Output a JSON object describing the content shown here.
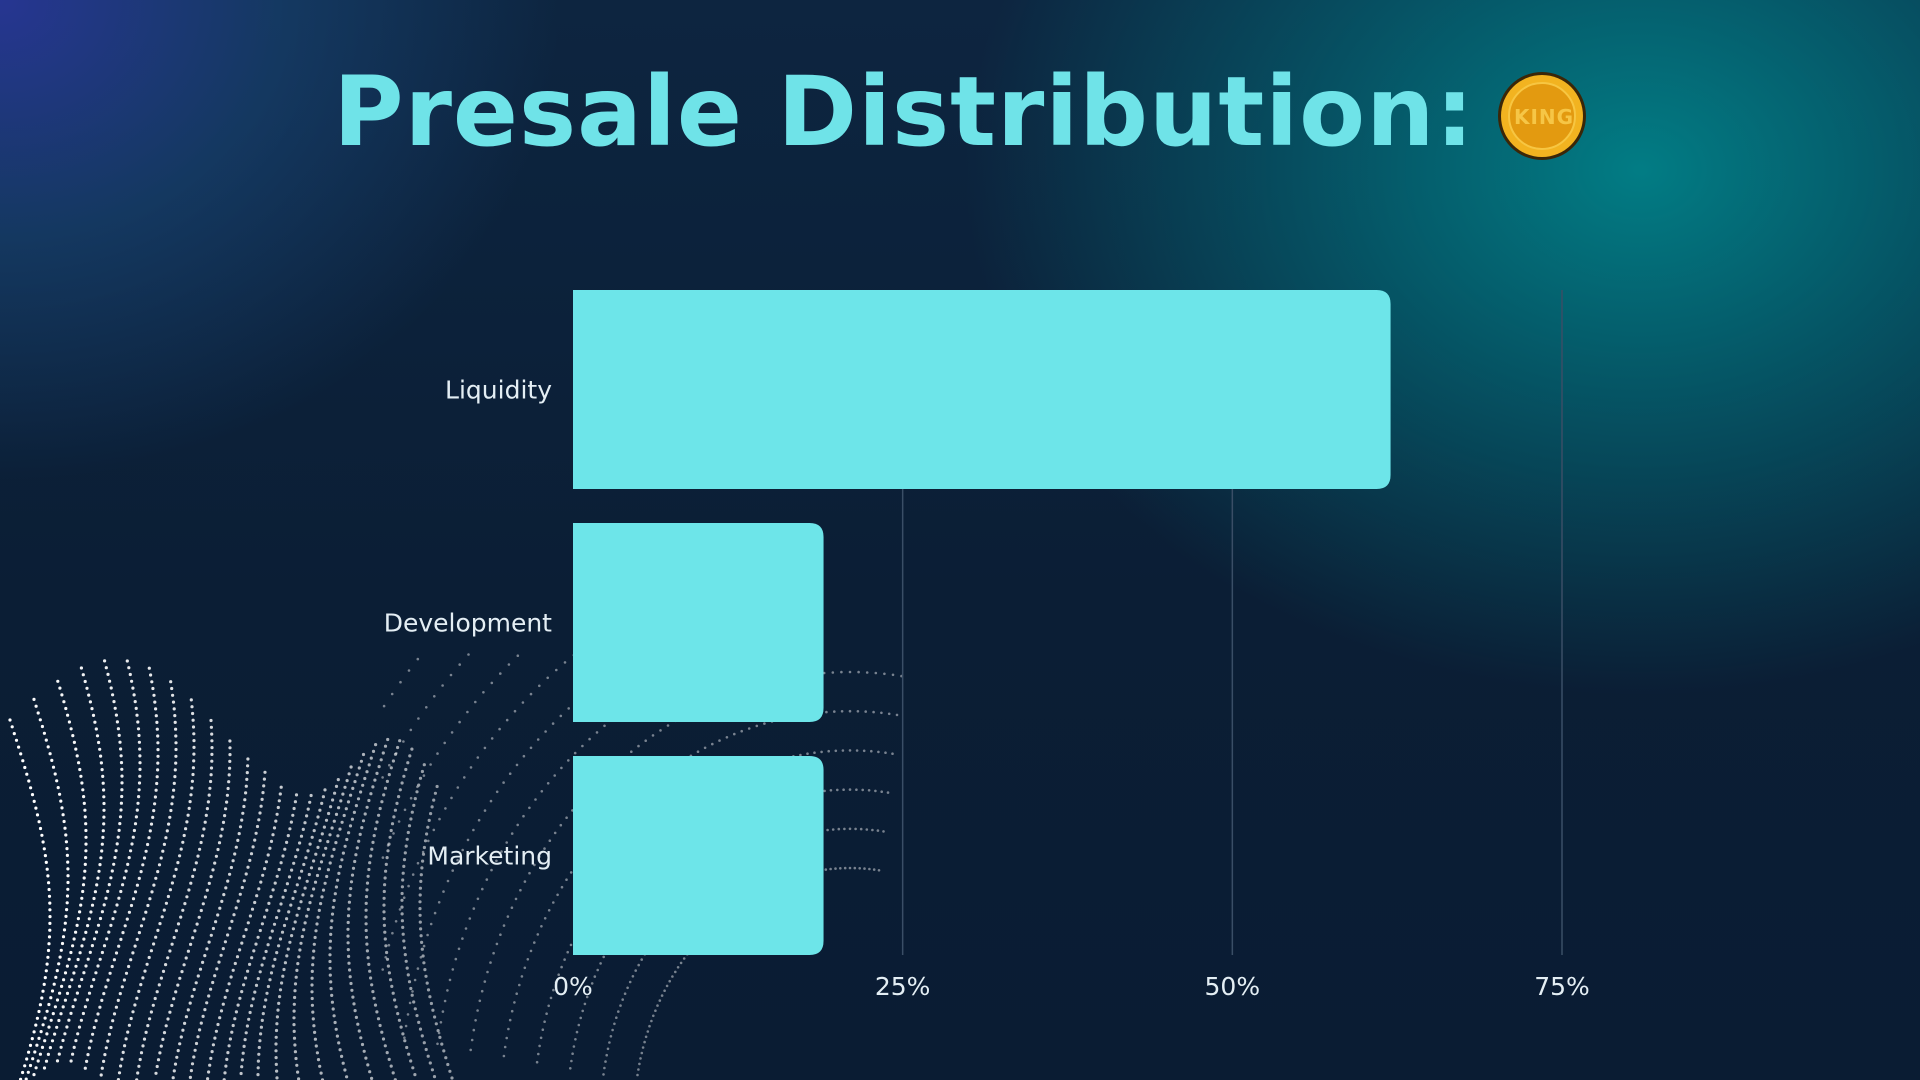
{
  "title": "Presale Distribution:",
  "coin_label": "KING",
  "colors": {
    "bar": "#6de5e9",
    "title": "#6fe3e8",
    "text": "#e4eef4",
    "grid": "#3a4e66",
    "coin": "#e8a514"
  },
  "chart_data": {
    "type": "bar",
    "orientation": "horizontal",
    "categories": [
      "Liquidity",
      "Development",
      "Marketing"
    ],
    "values": [
      62,
      19,
      19
    ],
    "xlim": [
      0,
      75
    ],
    "xticks": [
      0,
      25,
      50,
      75
    ],
    "xtick_labels": [
      "0%",
      "25%",
      "50%",
      "75%"
    ],
    "grid": true,
    "title": "Presale Distribution:"
  }
}
